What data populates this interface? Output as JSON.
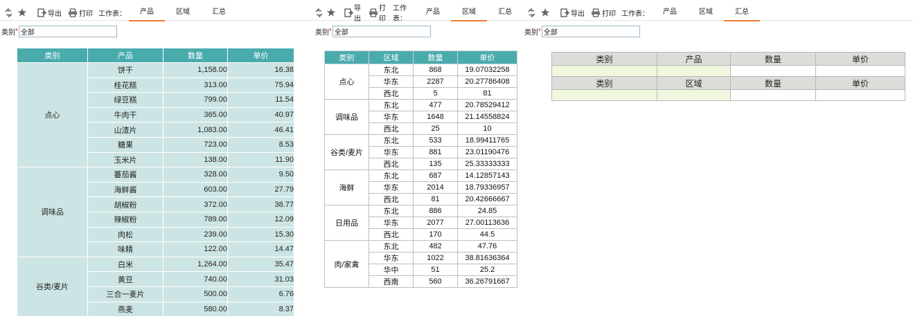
{
  "toolbar": {
    "export_label": "导出",
    "print_label": "打印",
    "worksheet_label": "工作表：",
    "tabs": [
      "产品",
      "区域",
      "汇总"
    ]
  },
  "filter": {
    "label": "类别",
    "required_mark": "*",
    "value": "全部"
  },
  "panels": [
    {
      "active_tab": 0
    },
    {
      "active_tab": 1
    },
    {
      "active_tab": 2
    }
  ],
  "product_table": {
    "headers": [
      "类别",
      "产品",
      "数量",
      "单价"
    ],
    "groups": [
      {
        "category": "点心",
        "rows": [
          [
            "饼干",
            "1,158.00",
            "16.38"
          ],
          [
            "桂花糕",
            "313.00",
            "75.94"
          ],
          [
            "绿豆糕",
            "799.00",
            "11.54"
          ],
          [
            "牛肉干",
            "365.00",
            "40.97"
          ],
          [
            "山渣片",
            "1,083.00",
            "46.41"
          ],
          [
            "糖果",
            "723.00",
            "8.53"
          ],
          [
            "玉米片",
            "138.00",
            "11.90"
          ]
        ]
      },
      {
        "category": "调味品",
        "rows": [
          [
            "蕃茄酱",
            "328.00",
            "9.50"
          ],
          [
            "海鲜酱",
            "603.00",
            "27.79"
          ],
          [
            "胡椒粉",
            "372.00",
            "38.77"
          ],
          [
            "辣椒粉",
            "789.00",
            "12.09"
          ],
          [
            "肉松",
            "239.00",
            "15.30"
          ],
          [
            "味精",
            "122.00",
            "14.47"
          ]
        ]
      },
      {
        "category": "谷类/麦片",
        "rows": [
          [
            "白米",
            "1,264.00",
            "35.47"
          ],
          [
            "黄豆",
            "740.00",
            "31.03"
          ],
          [
            "三合一麦片",
            "500.00",
            "6.76"
          ],
          [
            "燕麦",
            "580.00",
            "8.37"
          ]
        ]
      }
    ]
  },
  "region_table": {
    "headers": [
      "类别",
      "区域",
      "数量",
      "单价"
    ],
    "groups": [
      {
        "category": "点心",
        "rows": [
          [
            "东北",
            "868",
            "19.07032258"
          ],
          [
            "华东",
            "2287",
            "20.27786408"
          ],
          [
            "西北",
            "5",
            "81"
          ]
        ]
      },
      {
        "category": "调味品",
        "rows": [
          [
            "东北",
            "477",
            "20.78529412"
          ],
          [
            "华东",
            "1648",
            "21.14558824"
          ],
          [
            "西北",
            "25",
            "10"
          ]
        ]
      },
      {
        "category": "谷类/麦片",
        "rows": [
          [
            "东北",
            "533",
            "18.99411765"
          ],
          [
            "华东",
            "881",
            "23.01190476"
          ],
          [
            "西北",
            "135",
            "25.33333333"
          ]
        ]
      },
      {
        "category": "海鲜",
        "rows": [
          [
            "东北",
            "687",
            "14.12857143"
          ],
          [
            "华东",
            "2014",
            "18.79336957"
          ],
          [
            "西北",
            "81",
            "20.42666667"
          ]
        ]
      },
      {
        "category": "日用品",
        "rows": [
          [
            "东北",
            "886",
            "24.85"
          ],
          [
            "华东",
            "2077",
            "27.00113636"
          ],
          [
            "西北",
            "170",
            "44.5"
          ]
        ]
      },
      {
        "category": "肉/家禽",
        "rows": [
          [
            "东北",
            "482",
            "47.76"
          ],
          [
            "华东",
            "1022",
            "38.81636364"
          ],
          [
            "华中",
            "51",
            "25.2"
          ],
          [
            "西南",
            "560",
            "36.26791667"
          ]
        ]
      }
    ]
  },
  "summary_tables": [
    {
      "headers": [
        "类别",
        "产品",
        "数量",
        "单价"
      ]
    },
    {
      "headers": [
        "类别",
        "区域",
        "数量",
        "单价"
      ]
    }
  ],
  "icons": {
    "refresh": "refresh-icon",
    "star": "star-icon",
    "export": "export-icon",
    "print": "print-icon"
  },
  "colors": {
    "header_teal": "#4aabad",
    "cell_teal_light": "#cde4e4",
    "tab_active": "#f07a2d",
    "summary_header": "#dcdcd8",
    "summary_input": "#f0f7df"
  }
}
